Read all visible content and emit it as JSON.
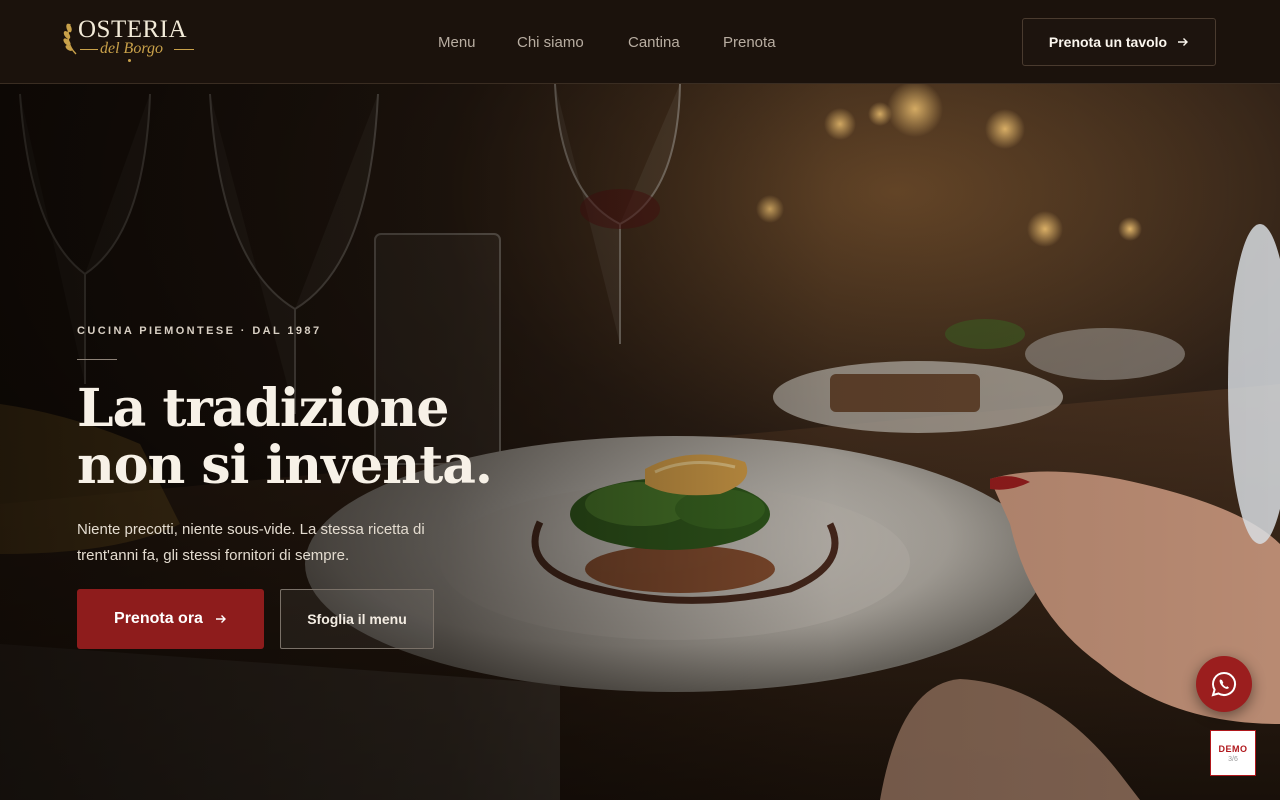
{
  "brand": {
    "name": "OSTERIA",
    "subname": "del Borgo",
    "accent": "#c9a14a"
  },
  "nav": {
    "items": [
      {
        "label": "Menu"
      },
      {
        "label": "Chi siamo"
      },
      {
        "label": "Cantina"
      },
      {
        "label": "Prenota"
      }
    ],
    "cta_label": "Prenota un tavolo",
    "cta_icon": "arrow-right-icon"
  },
  "hero": {
    "eyebrow": "CUCINA PIEMONTESE · DAL 1987",
    "headline_line1": "La tradizione",
    "headline_line2": "non si inventa.",
    "lead": "Niente precotti, niente sous-vide. La stessa ricetta di trent'anni fa, gli stessi fornitori di sempre.",
    "primary_button": "Prenota ora",
    "secondary_button": "Sfoglia il menu",
    "primary_color": "#8e1c1c"
  },
  "widgets": {
    "whatsapp_icon": "whatsapp-icon",
    "demo_label": "DEMO",
    "demo_counter": "3/6"
  }
}
